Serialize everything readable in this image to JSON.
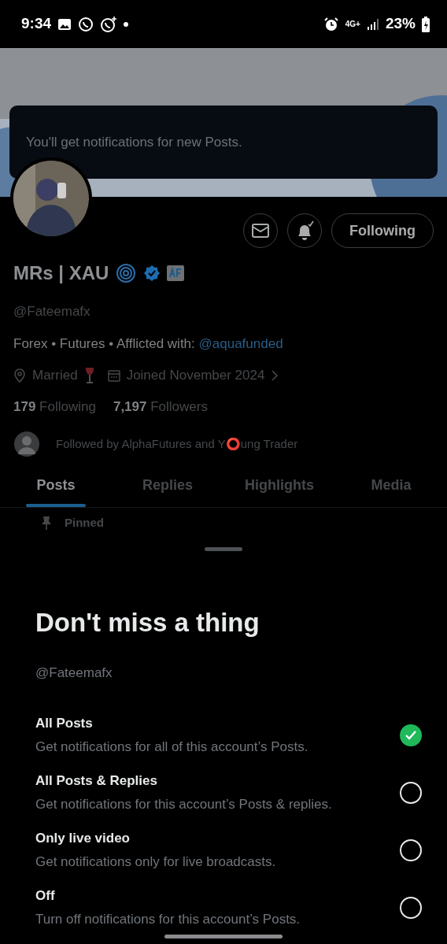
{
  "status_bar": {
    "time": "9:34",
    "network": "4G+",
    "battery": "23%"
  },
  "toast": {
    "text": "You'll get notifications for new Posts."
  },
  "profile": {
    "follow_button": "Following",
    "name": "MRs | XAU",
    "handle": "@Fateemafx",
    "bio": "Forex • Futures • Afflicted with: ",
    "bio_link": "@aquafunded",
    "location": "Married",
    "joined": "Joined November 2024",
    "stats": [
      {
        "count": "179",
        "label": "Following"
      },
      {
        "count": "7,197",
        "label": "Followers"
      }
    ],
    "followed_by": "Followed by AlphaFutures and Y⭕ung Trader"
  },
  "tabs": [
    {
      "label": "Posts",
      "selected": true
    },
    {
      "label": "Replies",
      "selected": false
    },
    {
      "label": "Highlights",
      "selected": false
    },
    {
      "label": "Media",
      "selected": false
    }
  ],
  "pinned": "Pinned",
  "sheet": {
    "title": "Don't miss a thing",
    "handle": "@Fateemafx",
    "options": [
      {
        "title": "All Posts",
        "description": "Get notifications for all of this account’s Posts.",
        "selected": true
      },
      {
        "title": "All Posts & Replies",
        "description": "Get notifications for this account’s Posts & replies.",
        "selected": false
      },
      {
        "title": "Only live video",
        "description": "Get notifications only for live broadcasts.",
        "selected": false
      },
      {
        "title": "Off",
        "description": "Turn off notifications for this account’s Posts.",
        "selected": false
      }
    ]
  }
}
